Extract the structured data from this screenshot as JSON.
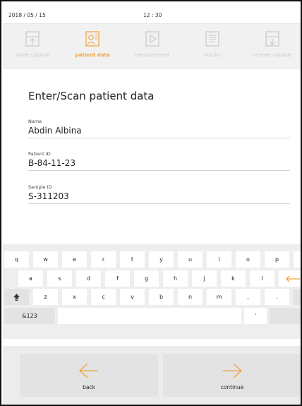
{
  "status": {
    "date": "2018 / 05 / 15",
    "time": "12 : 30"
  },
  "steps": [
    {
      "label": "insert capsule",
      "icon": "insert-capsule-icon",
      "active": false
    },
    {
      "label": "patient data",
      "icon": "patient-data-icon",
      "active": true
    },
    {
      "label": "measurement",
      "icon": "play-icon",
      "active": false
    },
    {
      "label": "results",
      "icon": "results-icon",
      "active": false
    },
    {
      "label": "remove capsule",
      "icon": "remove-capsule-icon",
      "active": false
    }
  ],
  "form": {
    "title": "Enter/Scan patient data",
    "fields": [
      {
        "label": "Name",
        "value": "Abdin Albina"
      },
      {
        "label": "Patient ID",
        "value": "B-84-11-23"
      },
      {
        "label": "Sample ID",
        "value": "S-311203"
      }
    ]
  },
  "keyboard": {
    "row1": [
      "q",
      "w",
      "e",
      "r",
      "t",
      "y",
      "u",
      "i",
      "o",
      "p"
    ],
    "row2": [
      "a",
      "s",
      "d",
      "f",
      "g",
      "h",
      "j",
      "k",
      "l"
    ],
    "row3": [
      "z",
      "x",
      "c",
      "v",
      "b",
      "n",
      "m",
      ",",
      "."
    ],
    "symbols_key": "&123",
    "apostrophe_key": "'",
    "backspace_icon": "backspace-icon",
    "enter_icon": "enter-icon",
    "shift_icon": "shift-icon"
  },
  "footer": {
    "back_label": "back",
    "continue_label": "continue"
  },
  "colors": {
    "accent": "#f0a23c",
    "inactive": "#c9c9c9"
  }
}
